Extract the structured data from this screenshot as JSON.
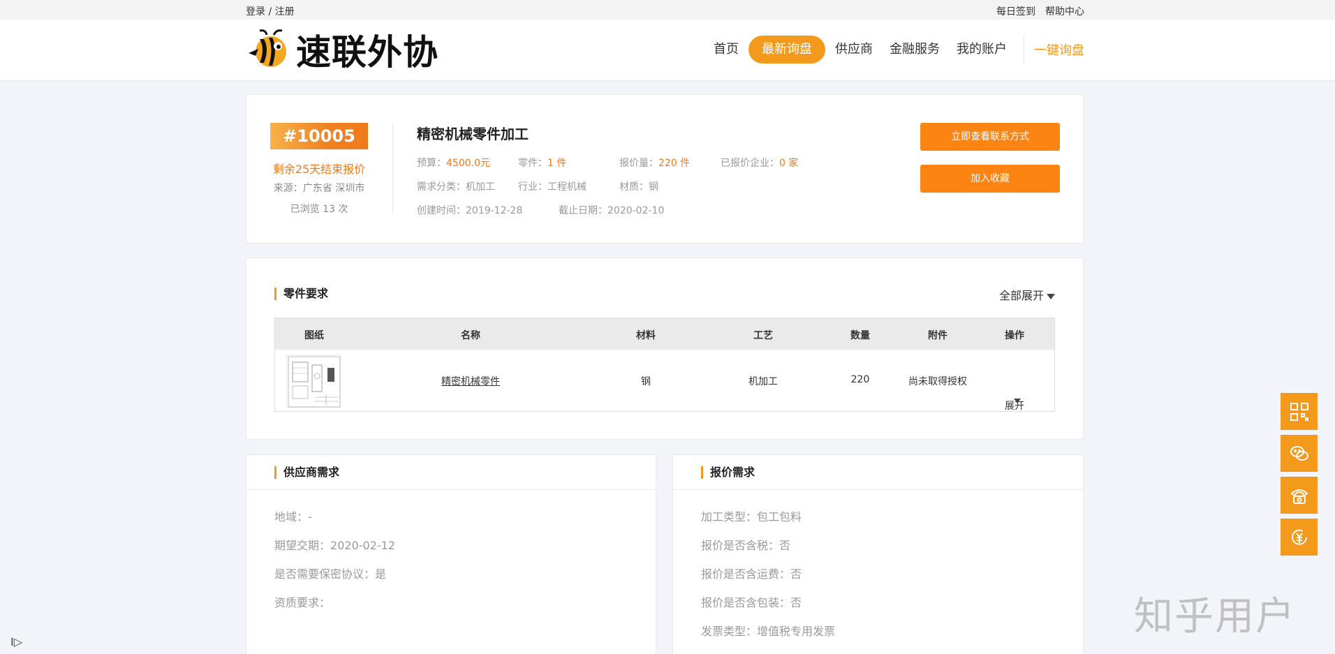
{
  "topbar": {
    "login": "登录 / 注册",
    "checkin": "每日签到",
    "help": "帮助中心"
  },
  "header": {
    "logo_text": "速联外协",
    "nav": [
      "首页",
      "最新询盘",
      "供应商",
      "金融服务",
      "我的账户"
    ],
    "cta": "一键询盘"
  },
  "project": {
    "id": "#10005",
    "remaining": "剩余25天结束报价",
    "source": "来源：广东省 深圳市",
    "views": "已浏览 13 次",
    "title": "精密机械零件加工",
    "budget_label": "预算：",
    "budget": "4500.0元",
    "parts_label": "零件：",
    "parts": "1 件",
    "quote_qty_label": "报价量：",
    "quote_qty": "220 件",
    "quoted_label": "已报价企业：",
    "quoted": "0 家",
    "category_label": "需求分类：",
    "category": "机加工",
    "industry_label": "行业：",
    "industry": "工程机械",
    "material_label": "材质：",
    "material": "钢",
    "created_label": "创建时间：",
    "created": "2019-12-28",
    "deadline_label": "截止日期：",
    "deadline": "2020-02-10",
    "btn_contact": "立即查看联系方式",
    "btn_fav": "加入收藏"
  },
  "parts_section": {
    "title": "零件要求",
    "expand_all": "全部展开",
    "columns": [
      "图纸",
      "名称",
      "材料",
      "工艺",
      "数量",
      "附件",
      "操作"
    ],
    "rows": [
      {
        "name": "精密机械零件",
        "material": "钢",
        "process": "机加工",
        "quantity": "220",
        "attachment": "尚未取得授权",
        "action": "展开"
      }
    ]
  },
  "supplier_section": {
    "title": "供应商需求",
    "items": [
      {
        "label": "地域：",
        "value": "-"
      },
      {
        "label": "期望交期：",
        "value": "2020-02-12"
      },
      {
        "label": "是否需要保密协议：",
        "value": "是"
      },
      {
        "label": "资质要求：",
        "value": ""
      }
    ]
  },
  "quote_section": {
    "title": "报价需求",
    "items": [
      {
        "label": "加工类型：",
        "value": "包工包料"
      },
      {
        "label": "报价是否含税：",
        "value": "否"
      },
      {
        "label": "报价是否含运费：",
        "value": "否"
      },
      {
        "label": "报价是否含包装：",
        "value": "否"
      },
      {
        "label": "发票类型：",
        "value": "增值税专用发票"
      }
    ]
  },
  "side_icons": [
    "qrcode-icon",
    "wechat-icon",
    "phone-icon",
    "finance-icon"
  ],
  "watermark": "知乎用户",
  "colors": {
    "accent": "#f39a1d",
    "orange_text": "#f07a1a",
    "button": "#fb8412"
  }
}
